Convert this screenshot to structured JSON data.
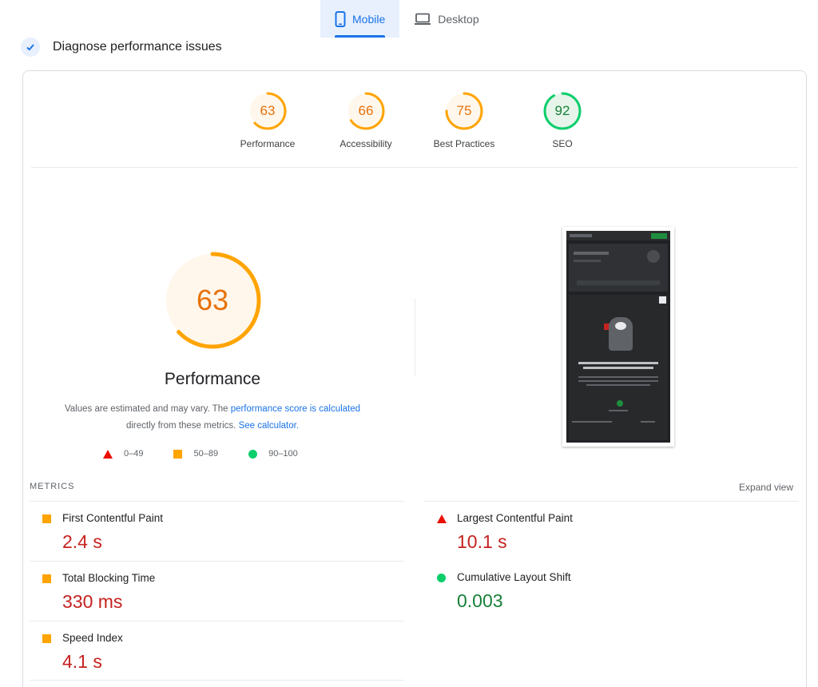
{
  "device_tabs": [
    {
      "label": "Mobile",
      "icon": "smartphone-icon",
      "active": true
    },
    {
      "label": "Desktop",
      "icon": "laptop-icon",
      "active": false
    }
  ],
  "diagnose": {
    "title": "Diagnose performance issues",
    "icon": "lighthouse-icon"
  },
  "scores": [
    {
      "label": "Performance",
      "value": "63",
      "status": "average",
      "color": "#e8710a"
    },
    {
      "label": "Accessibility",
      "value": "66",
      "status": "average",
      "color": "#e8710a"
    },
    {
      "label": "Best Practices",
      "value": "75",
      "status": "average",
      "color": "#e8710a"
    },
    {
      "label": "SEO",
      "value": "92",
      "status": "pass",
      "color": "#188038"
    }
  ],
  "main_gauge": {
    "value": "63",
    "title": "Performance",
    "fraction": 0.63
  },
  "note": {
    "text1": "Values are estimated and may vary. The ",
    "link1": "performance score is calculated",
    "text2": " directly from these metrics. ",
    "link2": "See calculator."
  },
  "legend": [
    {
      "range": "0–49",
      "shape": "triangle",
      "color": "#eb0f00"
    },
    {
      "range": "50–89",
      "shape": "square",
      "color": "#ffa400"
    },
    {
      "range": "90–100",
      "shape": "circle",
      "color": "#0cce6b"
    }
  ],
  "metrics_section": {
    "label": "METRICS",
    "expand_label": "Expand view"
  },
  "metrics": [
    {
      "name": "First Contentful Paint",
      "value": "2.4 s",
      "status": "average"
    },
    {
      "name": "Largest Contentful Paint",
      "value": "10.1 s",
      "status": "fail"
    },
    {
      "name": "Total Blocking Time",
      "value": "330 ms",
      "status": "average"
    },
    {
      "name": "Cumulative Layout Shift",
      "value": "0.003",
      "status": "pass"
    },
    {
      "name": "Speed Index",
      "value": "4.1 s",
      "status": "average"
    }
  ],
  "colors": {
    "accent": "#1a73e8",
    "average": "#ffa400",
    "fail": "#eb0f00",
    "pass": "#0cce6b",
    "average_text": "#e8710a",
    "fail_text": "#c5221f",
    "pass_text": "#188038"
  }
}
